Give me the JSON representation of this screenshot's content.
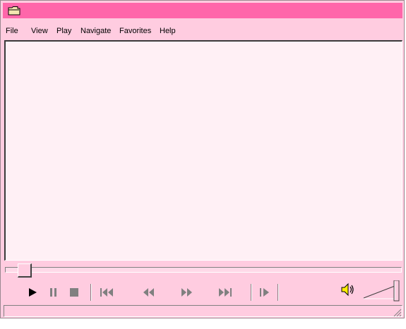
{
  "window": {
    "title": "",
    "colors": {
      "title_bar": "#ff66aa",
      "body": "#ffcce0",
      "video_area": "#fff0f5"
    }
  },
  "menu": {
    "items": [
      {
        "label": "File"
      },
      {
        "label": "View"
      },
      {
        "label": "Play"
      },
      {
        "label": "Navigate"
      },
      {
        "label": "Favorites"
      },
      {
        "label": "Help"
      }
    ]
  },
  "seek": {
    "position_fraction": 0.03
  },
  "controls": {
    "buttons": [
      {
        "icon": "play-icon"
      },
      {
        "icon": "pause-icon"
      },
      {
        "icon": "stop-icon"
      },
      {
        "icon": "skip-back-icon"
      },
      {
        "icon": "rewind-icon"
      },
      {
        "icon": "fast-forward-icon"
      },
      {
        "icon": "skip-forward-icon"
      },
      {
        "icon": "frame-step-icon"
      }
    ]
  },
  "volume": {
    "icon": "speaker-icon",
    "level_fraction": 1.0
  },
  "status": {
    "text": ""
  }
}
